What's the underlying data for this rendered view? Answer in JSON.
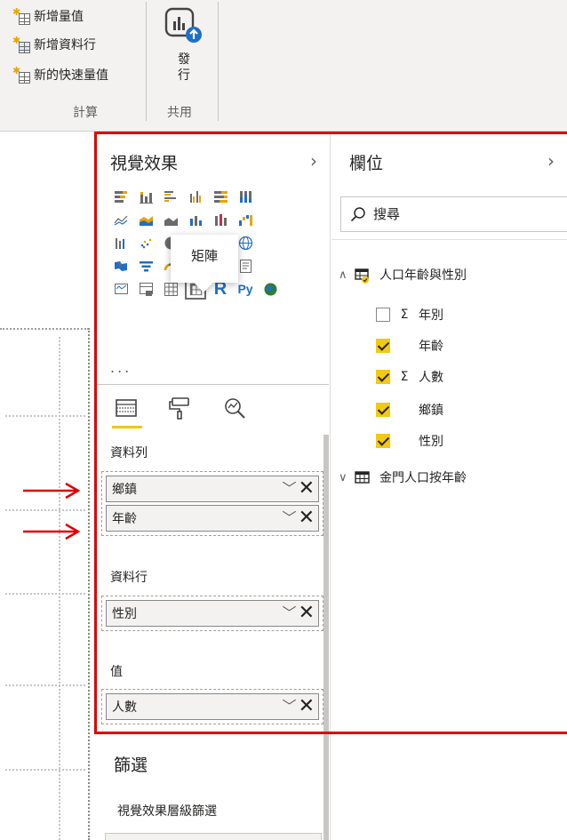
{
  "ribbon": {
    "calc_items": [
      "新增量值",
      "新增資料行",
      "新的快速量值"
    ],
    "calc_group_label": "計算",
    "publish_label": "發行",
    "share_group_label": "共用"
  },
  "visualizations": {
    "title": "視覺效果",
    "more": "...",
    "tooltip": "矩陣",
    "wells": {
      "rows_label": "資料列",
      "rows": [
        "鄉鎮",
        "年齡"
      ],
      "columns_label": "資料行",
      "columns": [
        "性別"
      ],
      "values_label": "值",
      "values": [
        "人數"
      ]
    },
    "filters_title": "篩選",
    "filters_sub": "視覺效果層級篩選"
  },
  "fields": {
    "title": "欄位",
    "search_placeholder": "搜尋",
    "tables": [
      {
        "name": "人口年齡與性別",
        "expanded": true,
        "fields": [
          {
            "name": "年別",
            "checked": false,
            "sigma": true
          },
          {
            "name": "年齡",
            "checked": true,
            "sigma": false
          },
          {
            "name": "人數",
            "checked": true,
            "sigma": true
          },
          {
            "name": "鄉鎮",
            "checked": true,
            "sigma": false
          },
          {
            "name": "性別",
            "checked": true,
            "sigma": false
          }
        ]
      },
      {
        "name": "金門人口按年齡",
        "expanded": false
      }
    ]
  },
  "icons": {
    "chevron_right": "›",
    "chevron_down_small": "﹀",
    "remove": "✕",
    "sigma": "Σ",
    "expand_up": "∧",
    "expand_down": "∨"
  },
  "colors": {
    "highlight_frame": "#e00000",
    "accent_yellow": "#f2c811",
    "arrow_red": "#e00000"
  }
}
